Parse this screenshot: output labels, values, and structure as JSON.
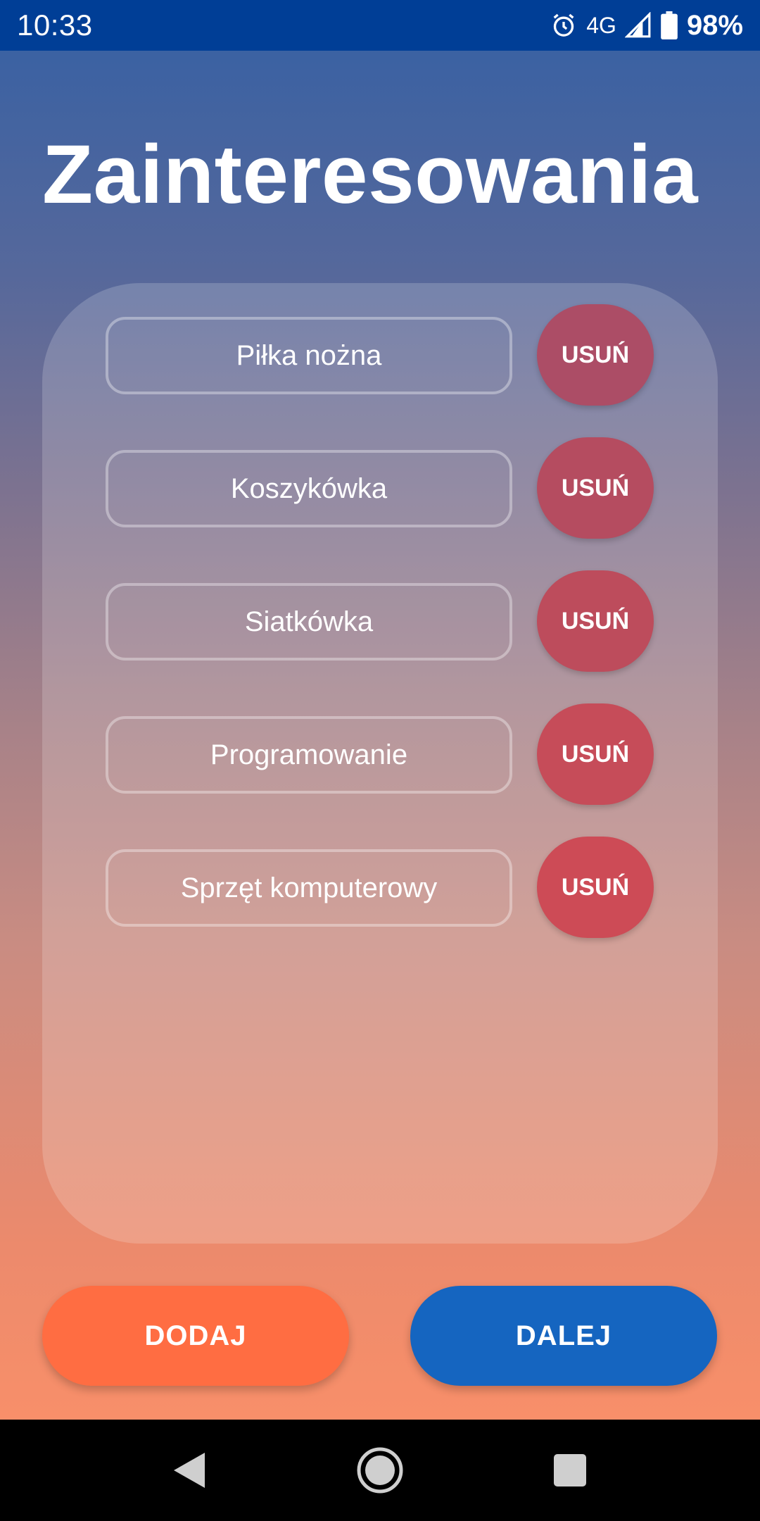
{
  "status_bar": {
    "time": "10:33",
    "network": "4G",
    "battery_percent": "98%",
    "icons": [
      "alarm-icon",
      "signal-icon",
      "battery-icon"
    ]
  },
  "page": {
    "title": "Zainteresowania"
  },
  "interests": [
    {
      "label": "Piłka nożna",
      "remove_label": "USUŃ",
      "remove_color": "#ac4d66"
    },
    {
      "label": "Koszykówka",
      "remove_label": "USUŃ",
      "remove_color": "#b54c60"
    },
    {
      "label": "Siatkówka",
      "remove_label": "USUŃ",
      "remove_color": "#bd4c5c"
    },
    {
      "label": "Programowanie",
      "remove_label": "USUŃ",
      "remove_color": "#c64c59"
    },
    {
      "label": "Sprzęt komputerowy",
      "remove_label": "USUŃ",
      "remove_color": "#cd4b56"
    }
  ],
  "actions": {
    "add_label": "DODAJ",
    "next_label": "DALEJ",
    "add_color": "#ff6d42",
    "next_color": "#1565c0"
  },
  "nav_bar": {
    "icons": [
      "back-icon",
      "home-icon",
      "recents-icon"
    ]
  }
}
